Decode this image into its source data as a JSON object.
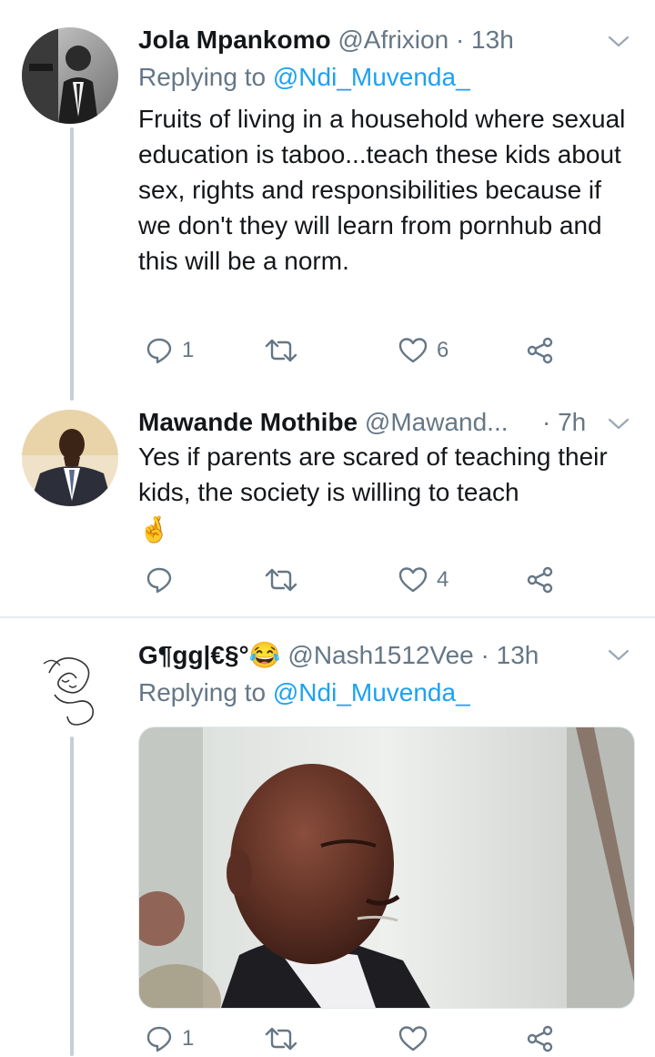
{
  "tweets": [
    {
      "name": "Jola Mpankomo",
      "handle": "@Afrixion",
      "time": "· 13h",
      "replying_prefix": "Replying to",
      "replying_to": "@Ndi_Muvenda_",
      "text": "Fruits of living in a household where sexual education is taboo...teach these kids about sex, rights and responsibilities because if we don't they will learn from pornhub and this will be a norm.",
      "reply_count": "1",
      "retweet_count": "",
      "like_count": "6"
    },
    {
      "name": "Mawande Mothibe",
      "handle": "@Mawand...",
      "time": "· 7h",
      "text": "Yes if parents are scared of teaching their kids, the society is willing to teach",
      "emoji": "🤞",
      "reply_count": "",
      "retweet_count": "",
      "like_count": "4"
    },
    {
      "name": "G¶gg|€§°",
      "name_emoji": "😂",
      "handle": "@Nash1512Vee",
      "time": "· 13h",
      "replying_prefix": "Replying to",
      "replying_to": "@Ndi_Muvenda_",
      "reply_count": "1",
      "retweet_count": "",
      "like_count": ""
    }
  ],
  "icons": {
    "reply": "reply-icon",
    "retweet": "retweet-icon",
    "like": "heart-icon",
    "share": "share-icon",
    "more": "chevron-down-icon"
  },
  "colors": {
    "secondary_text": "#657786",
    "link": "#1da1f2",
    "divider": "#e6ecf0",
    "thread_line": "#c4cfd6"
  }
}
